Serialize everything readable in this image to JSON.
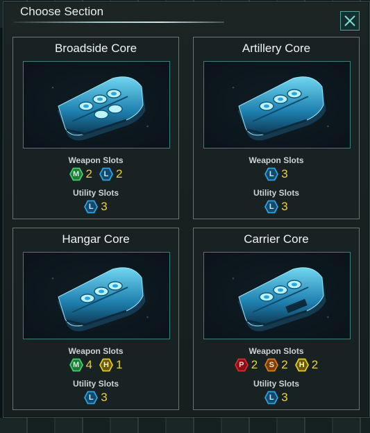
{
  "window": {
    "title": "Choose Section"
  },
  "cards": [
    {
      "name": "Broadside Core",
      "weapon_label": "Weapon Slots",
      "utility_label": "Utility Slots",
      "weapon_slots": [
        {
          "letter": "M",
          "count": "2",
          "type": "medium"
        },
        {
          "letter": "L",
          "count": "2",
          "type": "large"
        }
      ],
      "utility_slots": [
        {
          "letter": "L",
          "count": "3",
          "type": "large"
        }
      ]
    },
    {
      "name": "Artillery Core",
      "weapon_label": "Weapon Slots",
      "utility_label": "Utility Slots",
      "weapon_slots": [
        {
          "letter": "L",
          "count": "3",
          "type": "large"
        }
      ],
      "utility_slots": [
        {
          "letter": "L",
          "count": "3",
          "type": "large"
        }
      ]
    },
    {
      "name": "Hangar Core",
      "weapon_label": "Weapon Slots",
      "utility_label": "Utility Slots",
      "weapon_slots": [
        {
          "letter": "M",
          "count": "4",
          "type": "medium"
        },
        {
          "letter": "H",
          "count": "1",
          "type": "hangar"
        }
      ],
      "utility_slots": [
        {
          "letter": "L",
          "count": "3",
          "type": "large"
        }
      ]
    },
    {
      "name": "Carrier Core",
      "weapon_label": "Weapon Slots",
      "utility_label": "Utility Slots",
      "weapon_slots": [
        {
          "letter": "P",
          "count": "2",
          "type": "point-defense"
        },
        {
          "letter": "S",
          "count": "2",
          "type": "small"
        },
        {
          "letter": "H",
          "count": "2",
          "type": "hangar"
        }
      ],
      "utility_slots": [
        {
          "letter": "L",
          "count": "3",
          "type": "large"
        }
      ]
    }
  ],
  "slot_colors": {
    "medium": {
      "fill": "#1f7a3a",
      "stroke": "#3fd06a",
      "text": "#c9f7d5"
    },
    "large": {
      "fill": "#124a6e",
      "stroke": "#2aa6e6",
      "text": "#cbe9fb"
    },
    "hangar": {
      "fill": "#6b5a05",
      "stroke": "#e6cc1a",
      "text": "#fff6b0"
    },
    "point-defense": {
      "fill": "#8a0f14",
      "stroke": "#e0262e",
      "text": "#ffd6d6"
    },
    "small": {
      "fill": "#7a3e05",
      "stroke": "#e07a16",
      "text": "#ffe3c6"
    }
  },
  "icons": {
    "close": "close-icon",
    "slot": "hexagon-slot-icon"
  }
}
